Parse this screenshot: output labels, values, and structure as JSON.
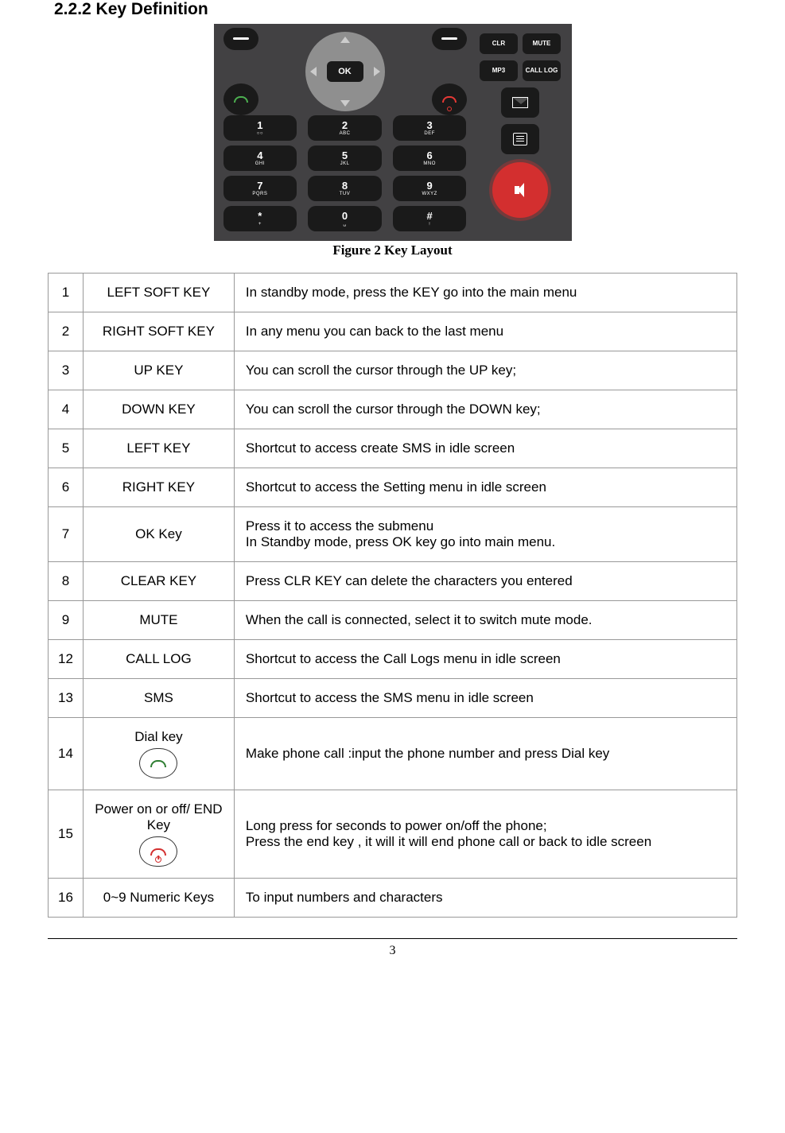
{
  "heading": "2.2.2   Key Definition",
  "figure_caption": "Figure 2 Key Layout",
  "keypad": {
    "ok": "OK",
    "numeric": [
      {
        "main": "1",
        "sub": "○○"
      },
      {
        "main": "2",
        "sub": "ABC"
      },
      {
        "main": "3",
        "sub": "DEF"
      },
      {
        "main": "4",
        "sub": "GHI"
      },
      {
        "main": "5",
        "sub": "JKL"
      },
      {
        "main": "6",
        "sub": "MNO"
      },
      {
        "main": "7",
        "sub": "PQRS"
      },
      {
        "main": "8",
        "sub": "TUV"
      },
      {
        "main": "9",
        "sub": "WXYZ"
      },
      {
        "main": "*",
        "sub": "+"
      },
      {
        "main": "0",
        "sub": "␣"
      },
      {
        "main": "#",
        "sub": "↑"
      }
    ],
    "side": {
      "clr": "CLR",
      "mute": "MUTE",
      "mp3": "MP3",
      "call_log": "CALL LOG"
    }
  },
  "table": [
    {
      "n": "1",
      "key": "LEFT SOFT  KEY",
      "desc": "In standby mode, press the KEY go into the main  menu"
    },
    {
      "n": "2",
      "key": "RIGHT SOFT KEY",
      "desc": "In any menu you can back to the last menu"
    },
    {
      "n": "3",
      "key": "UP KEY",
      "desc": "You can scroll the cursor through the UP key;"
    },
    {
      "n": "4",
      "key": "DOWN KEY",
      "desc": "You can scroll the cursor through the DOWN key;"
    },
    {
      "n": "5",
      "key": "LEFT KEY",
      "desc": "Shortcut to access create SMS in idle screen"
    },
    {
      "n": "6",
      "key": "RIGHT KEY",
      "desc": "Shortcut to access the Setting menu in idle screen"
    },
    {
      "n": "7",
      "key": "OK Key",
      "desc": "Press it to access the submenu\nIn Standby mode, press OK key go into main menu."
    },
    {
      "n": "8",
      "key": "CLEAR KEY",
      "desc": "Press CLR KEY can delete the characters you entered"
    },
    {
      "n": "9",
      "key": "MUTE",
      "desc": "When the call is connected, select it to switch mute mode."
    },
    {
      "n": "12",
      "key": "CALL LOG",
      "desc": "Shortcut to access the Call Logs menu in idle screen"
    },
    {
      "n": "13",
      "key": "SMS",
      "desc": "Shortcut to access the SMS menu in idle screen"
    },
    {
      "n": "14",
      "key": "Dial  key",
      "desc": "Make phone call :input the phone number and press Dial key",
      "icon": "dial"
    },
    {
      "n": "15",
      "key": "Power on or off/ END Key",
      "desc": "Long press for seconds to power on/off the phone;\nPress the end key , it will it will end phone call or back to idle screen",
      "icon": "end"
    },
    {
      "n": "16",
      "key": "0~9 Numeric Keys",
      "desc": "To input numbers and characters"
    }
  ],
  "page_number": "3"
}
